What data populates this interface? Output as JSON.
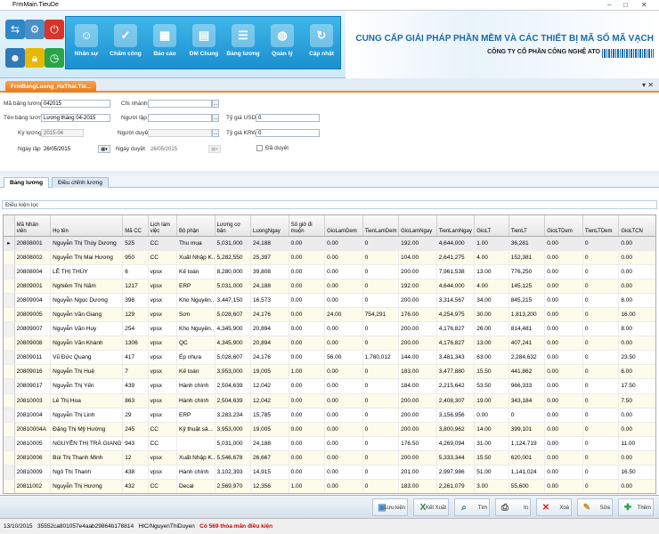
{
  "window": {
    "title": "FrmMain.TieuDe"
  },
  "ribbon": {
    "modules": [
      {
        "label": "Nhân sự",
        "icon": "people-icon"
      },
      {
        "label": "Chấm công",
        "icon": "checklist-icon"
      },
      {
        "label": "Báo cáo",
        "icon": "report-icon"
      },
      {
        "label": "DM Chung",
        "icon": "catalog-icon"
      },
      {
        "label": "Bảng lương",
        "icon": "payroll-icon"
      },
      {
        "label": "Quản lý",
        "icon": "manage-icon"
      },
      {
        "label": "Cập nhật",
        "icon": "update-icon"
      }
    ],
    "banner_title": "CUNG CẤP GIẢI PHÁP PHẦN MỀM VÀ CÁC THIẾT BỊ MÃ SỐ MÃ VẠCH",
    "banner_company": "CÔNG TY CỔ PHẦN CÔNG NGHỆ ATO"
  },
  "doc_tab": {
    "label": "FrmBangLuong_HaThai.Tie..."
  },
  "form": {
    "ma_bang_luong": {
      "label": "Mã bảng lương",
      "value": "042015"
    },
    "ten_bang_luong": {
      "label": "Tên bảng lương",
      "value": "Lương tháng 04-2015"
    },
    "ky_luong": {
      "label": "Kỳ lương",
      "value": "2015-04"
    },
    "ngay_lap": {
      "label": "Ngày lập",
      "value": "26/05/2015"
    },
    "chi_nhanh": {
      "label": "Chi nhánh",
      "value": ""
    },
    "nguoi_lap": {
      "label": "Người lập",
      "value": ""
    },
    "nguoi_duyet": {
      "label": "Người duyệt",
      "value": ""
    },
    "ngay_duyet": {
      "label": "Ngày duyệt",
      "value": "26/05/2015"
    },
    "ty_gia_usd": {
      "label": "Tỷ giá USD",
      "value": "0"
    },
    "ty_gia_krw": {
      "label": "Tỷ giá KRW",
      "value": "0"
    },
    "da_duyet": {
      "label": "Đã duyệt"
    }
  },
  "sub_tabs": [
    "Bảng lương",
    "Điều chỉnh lương"
  ],
  "filter": {
    "label": "Điều kiện lọc"
  },
  "grid": {
    "columns": [
      "Mã Nhân viên",
      "Họ tên",
      "Mã CC",
      "Lịch làm việc",
      "Bộ phận",
      "Lương cơ bản",
      "LuongNgay",
      "Số giờ đi muộn",
      "GioLamDem",
      "TienLamDem",
      "GioLamNgay",
      "TienLamNgay",
      "GioLT",
      "TienLT",
      "GioLTDem",
      "TienLTDem",
      "GioLTCN"
    ],
    "rows": [
      [
        "20808001",
        "Nguyễn Thị Thùy Dương",
        "525",
        "CC",
        "Thu mua",
        "5,031,000",
        "24,188",
        "0.00",
        "0.00",
        "0",
        "192.00",
        "4,644,000",
        "1.00",
        "36,281",
        "0.00",
        "0",
        "0.00"
      ],
      [
        "20808002",
        "Nguyễn Thị Mai Hương",
        "950",
        "CC",
        "Xuất Nhập K...",
        "5,282,550",
        "25,397",
        "0.00",
        "0.00",
        "0",
        "104.00",
        "2,641,275",
        "4.00",
        "152,381",
        "0.00",
        "0",
        "0.00"
      ],
      [
        "20808004",
        "LÊ THỊ THÚY",
        "6",
        "vpsx",
        "Kế toán",
        "8,280,000",
        "39,808",
        "0.00",
        "0.00",
        "0",
        "200.00",
        "7,961,538",
        "13.00",
        "776,250",
        "0.00",
        "0",
        "0.00"
      ],
      [
        "20809001",
        "Nghiêm Thị Nấm",
        "1217",
        "vpsx",
        "ERP",
        "5,031,000",
        "24,188",
        "0.00",
        "0.00",
        "0",
        "192.00",
        "4,644,000",
        "4.00",
        "145,125",
        "0.00",
        "0",
        "0.00"
      ],
      [
        "20809004",
        "Nguyễn Ngọc Dương",
        "398",
        "vpsx",
        "Kho Nguyên...",
        "3,447,150",
        "16,573",
        "0.00",
        "0.00",
        "0",
        "200.00",
        "3,314,567",
        "34.00",
        "845,215",
        "0.00",
        "0",
        "8.00"
      ],
      [
        "20809005",
        "Nguyễn Văn Giang",
        "129",
        "vpsx",
        "Sơn",
        "5,028,607",
        "24,176",
        "0.00",
        "24.00",
        "754,291",
        "176.00",
        "4,254,975",
        "30.00",
        "1,813,200",
        "0.00",
        "0",
        "16.00"
      ],
      [
        "20809007",
        "Nguyễn Văn Huy",
        "254",
        "vpsx",
        "Kho Nguyên...",
        "4,345,900",
        "20,894",
        "0.00",
        "0.00",
        "0",
        "200.00",
        "4,176,827",
        "26.00",
        "814,481",
        "0.00",
        "0",
        "8.00"
      ],
      [
        "20809008",
        "Nguyễn Văn Khánh",
        "1306",
        "vpsx",
        "QC",
        "4,345,900",
        "20,894",
        "0.00",
        "0.00",
        "0",
        "200.00",
        "4,176,827",
        "13.00",
        "407,241",
        "0.00",
        "0",
        "0.00"
      ],
      [
        "20809011",
        "Vũ Đức Quang",
        "417",
        "vpsx",
        "Ép nhựa",
        "5,028,607",
        "24,176",
        "0.00",
        "56.00",
        "1,760,012",
        "144.00",
        "3,481,343",
        "63.00",
        "2,284,632",
        "0.00",
        "0",
        "23.50"
      ],
      [
        "20809016",
        "Nguyễn Thị Huệ",
        "7",
        "vpsx",
        "Kế toán",
        "3,953,000",
        "19,005",
        "1.00",
        "0.00",
        "0",
        "183.00",
        "3,477,880",
        "15.50",
        "441,862",
        "0.00",
        "0",
        "6.00"
      ],
      [
        "20809017",
        "Nguyễn Thị Yến",
        "439",
        "vpsx",
        "Hành chính",
        "2,504,639",
        "12,042",
        "0.00",
        "0.00",
        "0",
        "184.00",
        "2,215,642",
        "53.50",
        "966,333",
        "0.00",
        "0",
        "17.50"
      ],
      [
        "20810003",
        "Lê Thị Hoa",
        "863",
        "vpsx",
        "Hành chính",
        "2,504,639",
        "12,042",
        "0.00",
        "0.00",
        "0",
        "200.00",
        "2,408,307",
        "19.00",
        "343,184",
        "0.00",
        "0",
        "7.50"
      ],
      [
        "20810004",
        "Nguyễn Thị Linh",
        "29",
        "vpsx",
        "ERP",
        "3,283,234",
        "15,785",
        "0.00",
        "0.00",
        "0",
        "200.00",
        "3,156,956",
        "0.00",
        "0",
        "0.00",
        "0",
        "0.00"
      ],
      [
        "20810004A",
        "Đặng Thị Mỹ Hường",
        "245",
        "CC",
        "Kỹ thuật sả...",
        "3,953,000",
        "19,005",
        "0.00",
        "0.00",
        "0",
        "200.00",
        "3,800,962",
        "14.00",
        "399,101",
        "0.00",
        "0",
        "0.00"
      ],
      [
        "20810005",
        "NGUYỄN THỊ TRÀ GIANG",
        "943",
        "CC",
        "",
        "5,031,000",
        "24,188",
        "0.00",
        "0.00",
        "0",
        "176.50",
        "4,269,094",
        "31.00",
        "1,124,719",
        "0.00",
        "0",
        "11.00"
      ],
      [
        "20810006",
        "Bùi Thị Thanh Minh",
        "12",
        "vpsx",
        "Xuất Nhập K...",
        "5,546,678",
        "26,667",
        "0.00",
        "0.00",
        "0",
        "200.00",
        "5,333,344",
        "15.50",
        "620,001",
        "0.00",
        "0",
        "0.00"
      ],
      [
        "20810009",
        "Ngô Thị Thanh",
        "438",
        "vpsx",
        "Hành chính",
        "3,102,393",
        "14,915",
        "0.00",
        "0.00",
        "0",
        "201.00",
        "2,997,986",
        "51.00",
        "1,141,024",
        "0.00",
        "0",
        "16.50"
      ],
      [
        "20811002",
        "Nguyễn Thị Hương",
        "432",
        "CC",
        "Decal",
        "2,569,970",
        "12,356",
        "1.00",
        "0.00",
        "0",
        "183.00",
        "2,261,079",
        "3.00",
        "55,600",
        "0.00",
        "0",
        "0.00"
      ]
    ]
  },
  "toolbar": {
    "buttons": [
      {
        "label": "Lưu kiện",
        "icon": "save-icon"
      },
      {
        "label": "Kết Xuất",
        "icon": "excel-icon"
      },
      {
        "label": "Tìm",
        "icon": "search-icon"
      },
      {
        "label": "In",
        "icon": "print-icon"
      },
      {
        "label": "Xoá",
        "icon": "delete-icon"
      },
      {
        "label": "Sửa",
        "icon": "edit-icon"
      },
      {
        "label": "Thêm",
        "icon": "add-icon"
      }
    ]
  },
  "status": {
    "date": "13/10/2015",
    "machine_id": "35552ca801057e4aab29864b178814",
    "user": "HIC/NguyenThiDuyen",
    "message": "Có 569 thỏa mãn điều kiện"
  },
  "colors": {
    "ribbon_module": "#1b8fd0",
    "doc_tab": "#e9781c",
    "banner_text": "#1a6aaa",
    "status_warn": "#cc0000"
  }
}
